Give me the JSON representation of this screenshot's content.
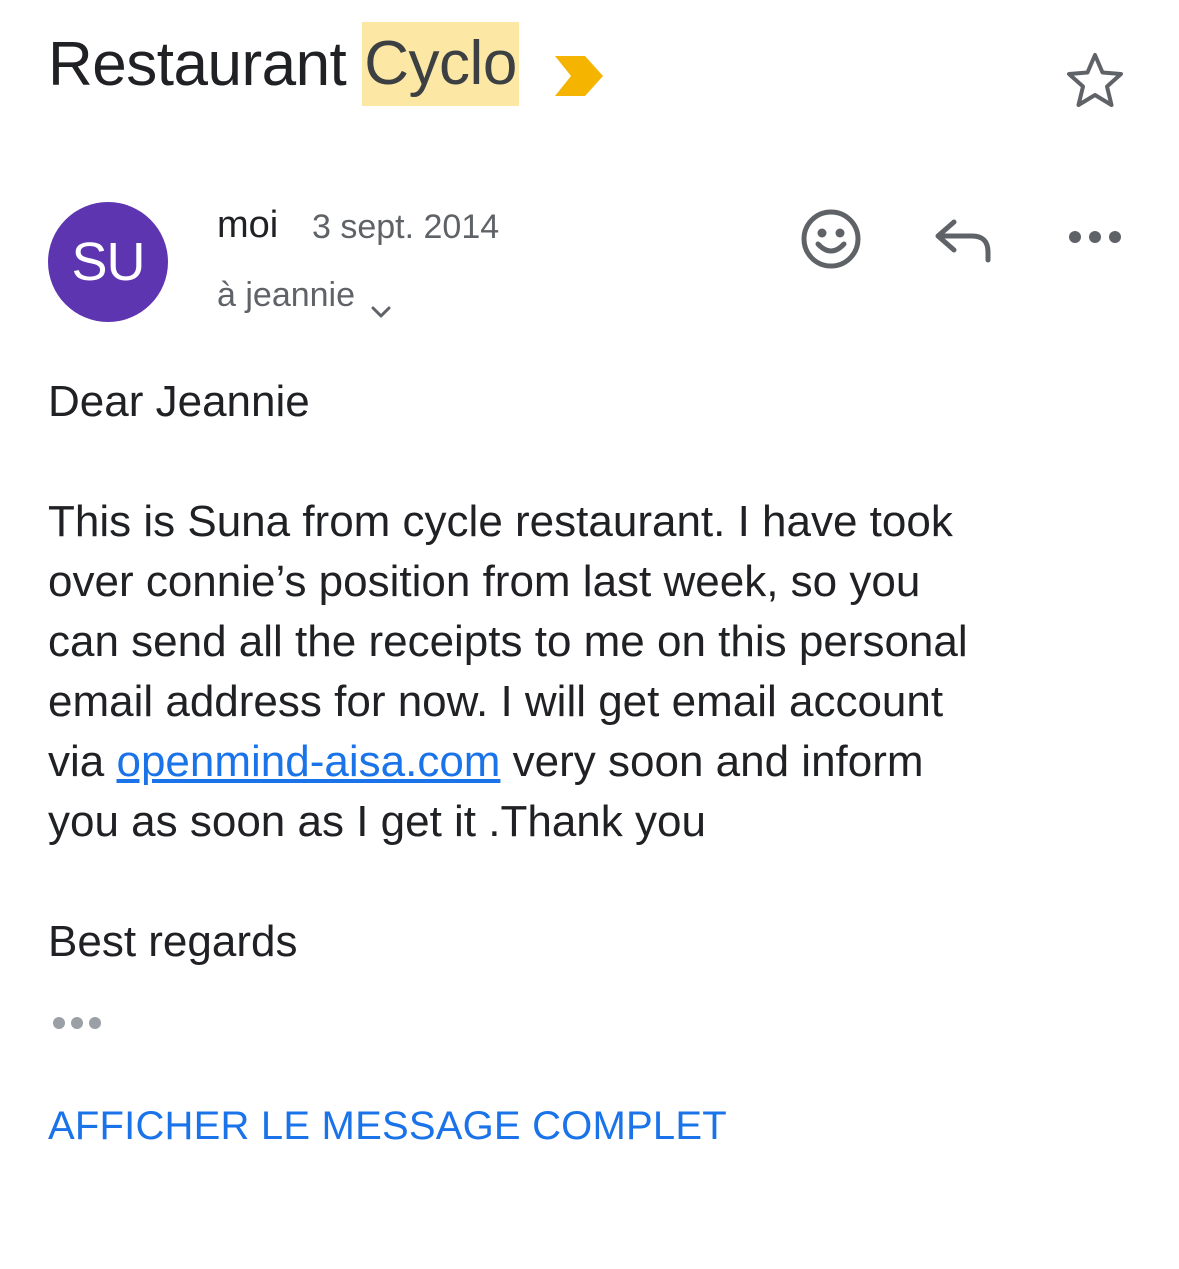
{
  "subject": {
    "prefix": "Restaurant",
    "highlight": "Cyclo",
    "important_icon": "important-marker-icon",
    "star_icon": "star-outline-icon"
  },
  "sender": {
    "avatar_initials": "SU",
    "avatar_color": "#5e35b1",
    "name": "moi",
    "date": "3 sept. 2014",
    "recipient": "à jeannie",
    "recipient_icon": "chevron-down-icon"
  },
  "actions": {
    "emoji_icon": "emoji-reaction-icon",
    "reply_icon": "reply-icon",
    "more_icon": "more-horizontal-icon"
  },
  "message": {
    "greeting": "Dear Jeannie",
    "lines": [
      "This is Suna from cycle restaurant. I have took",
      "over connie’s position from last week, so you",
      "can send all the receipts to me on this personal",
      "email address for now. I will get email account"
    ],
    "line5_before": "via ",
    "link_text": "openmind-aisa.com",
    "line5_after": " very soon and inform",
    "line6": "you as soon as I get it .Thank you",
    "signoff": "Best regards",
    "trimmed_icon": "trimmed-content-icon"
  },
  "show_full_label": "AFFICHER LE MESSAGE COMPLET",
  "colors": {
    "highlight_bg": "#fce8a4",
    "important_marker": "#f4b400",
    "link": "#1a73e8",
    "secondary_text": "#5f6368"
  }
}
